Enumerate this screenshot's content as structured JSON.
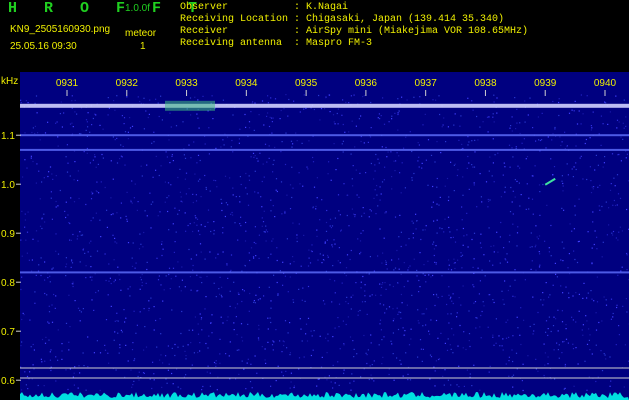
{
  "header": {
    "brand": "H R O F F T",
    "version": "1.0.0f",
    "filename": "KN9_2505160930.png",
    "meteor_label": "meteor",
    "datetime": "25.05.16 09:30",
    "meteor_count": "1"
  },
  "info": [
    {
      "key": "Observer",
      "value": "K.Nagai"
    },
    {
      "key": "Receiving Location",
      "value": "Chigasaki, Japan (139.414 35.340)"
    },
    {
      "key": "Receiver",
      "value": "AirSpy mini (Miakejima VOR 108.65MHz)"
    },
    {
      "key": "Receiving antenna",
      "value": "Maspro FM-3"
    }
  ],
  "chart_data": {
    "type": "heatmap",
    "ylabel": "kHz",
    "y_ticks": [
      "1.1",
      "1.0",
      "0.9",
      "0.8",
      "0.7",
      "0.6"
    ],
    "y_tick_values": [
      1.1,
      1.0,
      0.9,
      0.8,
      0.7,
      0.6
    ],
    "time_ticks": [
      "0931",
      "0932",
      "0933",
      "0934",
      "0935",
      "0936",
      "0937",
      "0938",
      "0939",
      "0940"
    ],
    "ylim": [
      0.58,
      1.18
    ],
    "horizontal_lines_khz": [
      1.16,
      1.1,
      1.07,
      0.82
    ],
    "meteor_echo": {
      "time": "0939",
      "freq_khz": 1.005
    },
    "colors": {
      "background": "#000080",
      "carrier": "#d0d0ff",
      "text_green": "#20d020",
      "text_yellow": "#f0f000",
      "tick_line": "#d0d0d0",
      "spectrum": "#00e0e0"
    }
  }
}
